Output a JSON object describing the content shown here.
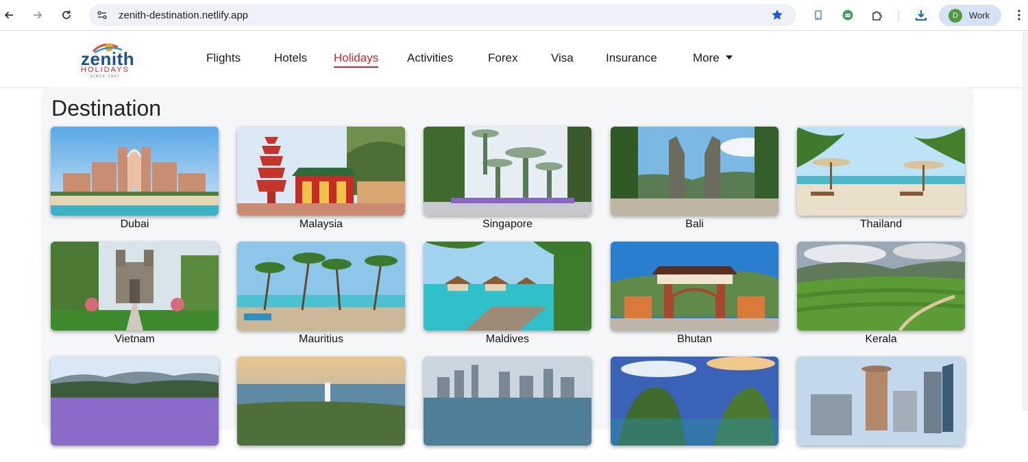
{
  "browser": {
    "url": "zenith-destination.netlify.app",
    "profile_initial": "D",
    "profile_name": "Work",
    "accent": "#1a73e8"
  },
  "header": {
    "logo_text": "zenith",
    "logo_sub": "HOLIDAYS",
    "logo_since": "SINCE 1997",
    "nav": [
      {
        "label": "Flights"
      },
      {
        "label": "Hotels"
      },
      {
        "label": "Holidays",
        "active": true
      },
      {
        "label": "Activities"
      },
      {
        "label": "Forex"
      },
      {
        "label": "Visa"
      },
      {
        "label": "Insurance"
      },
      {
        "label": "More"
      }
    ],
    "active_color": "#d6242a"
  },
  "main": {
    "title": "Destination",
    "destinations": [
      {
        "name": "Dubai"
      },
      {
        "name": "Malaysia"
      },
      {
        "name": "Singapore"
      },
      {
        "name": "Bali"
      },
      {
        "name": "Thailand"
      },
      {
        "name": "Vietnam"
      },
      {
        "name": "Mauritius"
      },
      {
        "name": "Maldives"
      },
      {
        "name": "Bhutan"
      },
      {
        "name": "Kerala"
      },
      {
        "name": ""
      },
      {
        "name": ""
      },
      {
        "name": ""
      },
      {
        "name": ""
      },
      {
        "name": ""
      }
    ]
  }
}
